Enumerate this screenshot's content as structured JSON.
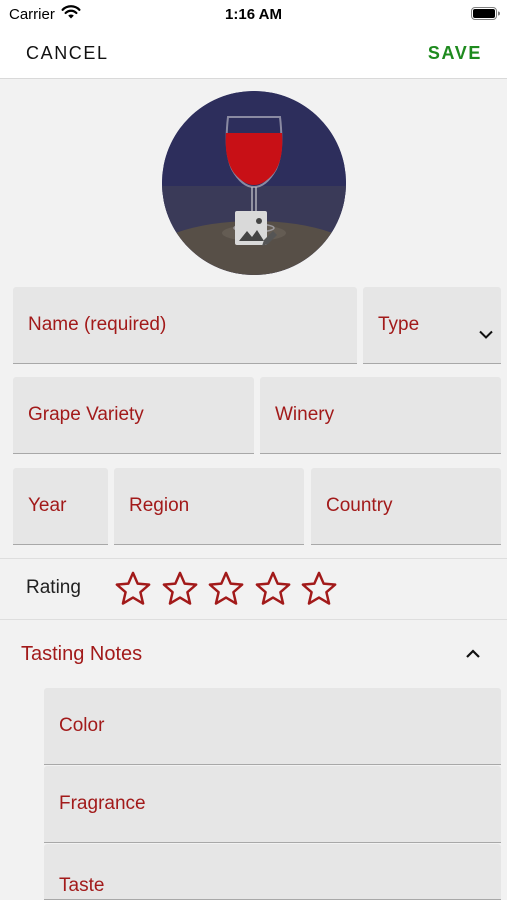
{
  "status_bar": {
    "carrier": "Carrier",
    "time": "1:16 AM",
    "wifi_icon": "wifi-icon",
    "battery_icon": "battery-icon"
  },
  "nav": {
    "cancel_label": "CANCEL",
    "save_label": "SAVE",
    "save_color": "#1e8a1e"
  },
  "photo": {
    "image_icon": "edit-image-icon"
  },
  "fields": {
    "name": "Name  (required)",
    "type": "Type",
    "grape_variety": "Grape Variety",
    "winery": "Winery",
    "year": "Year",
    "region": "Region",
    "country": "Country"
  },
  "rating": {
    "label": "Rating",
    "value": 0,
    "max": 5,
    "star_color": "#a21a1a"
  },
  "tasting_notes": {
    "title": "Tasting Notes",
    "expanded": true,
    "fields": {
      "color": "Color",
      "fragrance": "Fragrance",
      "taste": "Taste"
    }
  },
  "accent_color": "#a21a1a"
}
